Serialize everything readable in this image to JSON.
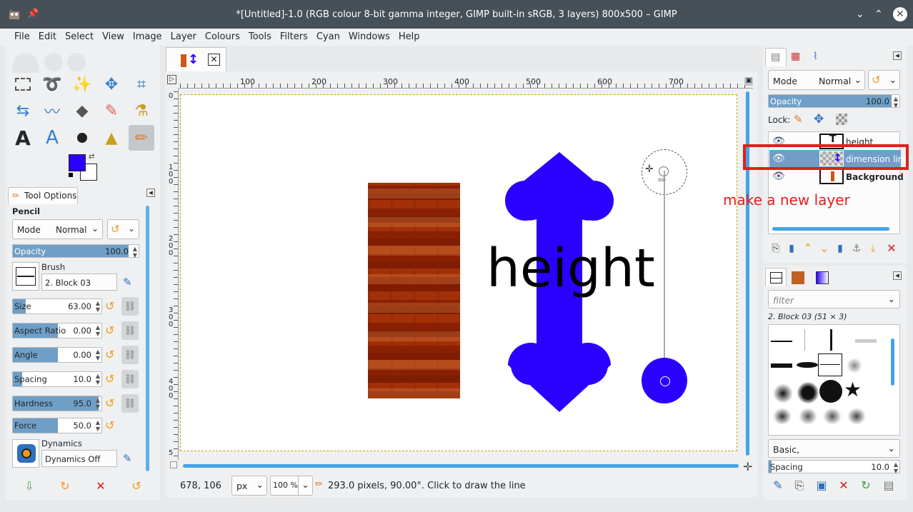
{
  "window": {
    "title": "*[Untitled]-1.0 (RGB colour 8-bit gamma integer, GIMP built-in sRGB, 3 layers) 800x500 – GIMP"
  },
  "menu": [
    "File",
    "Edit",
    "Select",
    "View",
    "Image",
    "Layer",
    "Colours",
    "Tools",
    "Filters",
    "Cyan",
    "Windows",
    "Help"
  ],
  "colors": {
    "foreground": "#2a00ff",
    "background": "#ffffff",
    "accent": "#45a3e6",
    "annotation": "#e0201c"
  },
  "tool_options": {
    "tab_label": "Tool Options",
    "tool_name": "Pencil",
    "mode_label": "Mode",
    "mode_value": "Normal",
    "opacity_label": "Opacity",
    "opacity_value": "100.0",
    "opacity_fraction": 1.0,
    "brush_label": "Brush",
    "brush_value": "2. Block 03",
    "params": [
      {
        "label": "Size",
        "value": "63.00",
        "fraction": 0.14
      },
      {
        "label": "Aspect Ratio",
        "value": "0.00",
        "fraction": 0.5
      },
      {
        "label": "Angle",
        "value": "0.00",
        "fraction": 0.5
      },
      {
        "label": "Spacing",
        "value": "10.0",
        "fraction": 0.1
      },
      {
        "label": "Hardness",
        "value": "95.0",
        "fraction": 0.95
      },
      {
        "label": "Force",
        "value": "50.0",
        "fraction": 0.5
      }
    ],
    "dynamics_label": "Dynamics",
    "dynamics_value": "Dynamics Off"
  },
  "canvas": {
    "tab_icon": "dimension-line-thumb",
    "ruler_h": [
      "100",
      "200",
      "300",
      "400",
      "500",
      "600",
      "700"
    ],
    "ruler_v": [
      "0",
      "1\n0\n0",
      "2\n0\n0",
      "3\n0\n0",
      "4\n0\n0",
      "5"
    ],
    "text_layer": "height"
  },
  "status": {
    "coords": "678, 106",
    "unit": "px",
    "zoom": "100 %",
    "message": "293.0 pixels, 90.00°. Click to draw the line"
  },
  "layers_panel": {
    "mode_label": "Mode",
    "mode_value": "Normal",
    "opacity_label": "Opacity",
    "opacity_value": "100.0",
    "lock_label": "Lock:",
    "layers": [
      {
        "name": "height",
        "selected": false
      },
      {
        "name": "dimension line",
        "selected": true
      },
      {
        "name": "Background",
        "selected": false
      }
    ],
    "annotation": "make a new layer"
  },
  "brushes_panel": {
    "filter_placeholder": "filter",
    "brush_title": "2. Block 03 (51 × 3)",
    "preset_value": "Basic,",
    "spacing_label": "Spacing",
    "spacing_value": "10.0"
  }
}
